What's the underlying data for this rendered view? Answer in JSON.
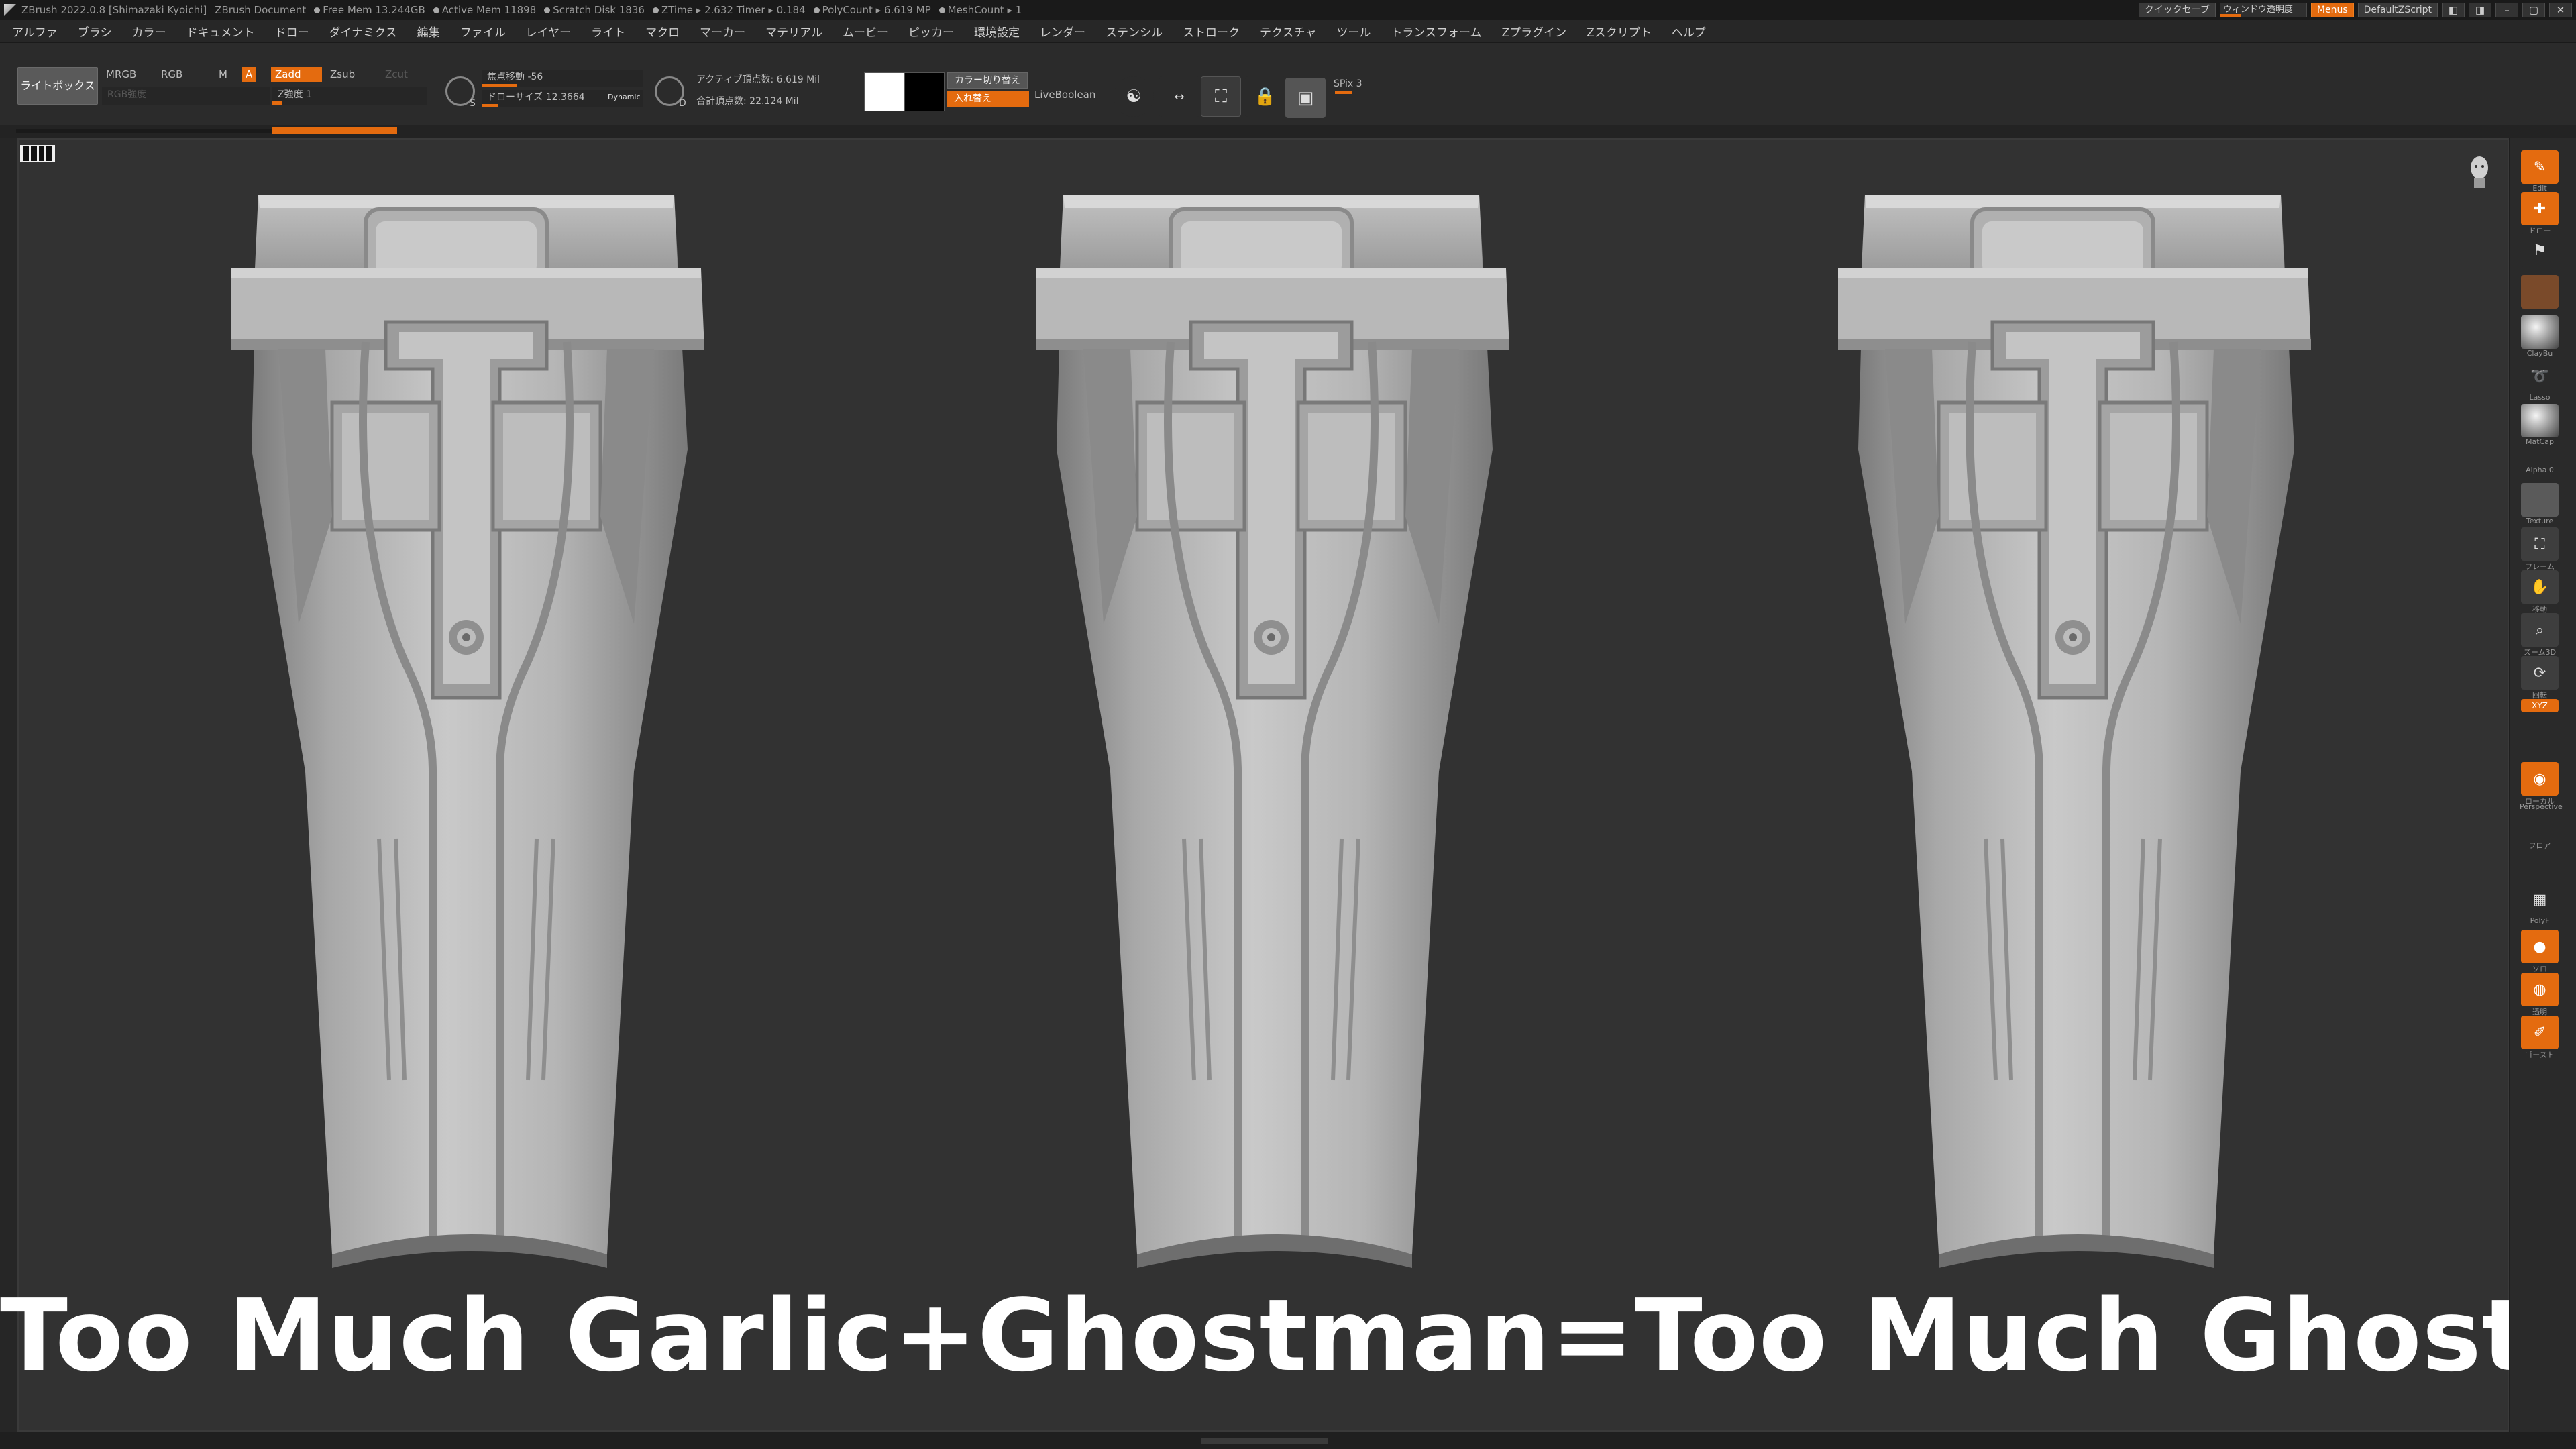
{
  "titlebar": {
    "app": "ZBrush 2022.0.8 [Shimazaki Kyoichi]",
    "document": "ZBrush Document",
    "free_mem": "Free Mem 13.244GB",
    "active_mem": "Active Mem 11898",
    "scratch_disk": "Scratch Disk 1836",
    "ztime": "ZTime ▸ 2.632 Timer ▸ 0.184",
    "polycount": "PolyCount ▸ 6.619 MP",
    "meshcount": "MeshCount ▸ 1",
    "quicksave": "クイックセーブ",
    "window_transparency": "ウィンドウ透明度",
    "menus": "Menus",
    "default_zscript": "DefaultZScript"
  },
  "menu": [
    "アルファ",
    "ブラシ",
    "カラー",
    "ドキュメント",
    "ドロー",
    "ダイナミクス",
    "編集",
    "ファイル",
    "レイヤー",
    "ライト",
    "マクロ",
    "マーカー",
    "マテリアル",
    "ムービー",
    "ピッカー",
    "環境設定",
    "レンダー",
    "ステンシル",
    "ストローク",
    "テクスチャ",
    "ツール",
    "トランスフォーム",
    "Zプラグイン",
    "Zスクリプト",
    "ヘルプ"
  ],
  "toolbar": {
    "lightbox": "ライトボックス",
    "mrgb": "MRGB",
    "rgb": "RGB",
    "m": "M",
    "a": "A",
    "zadd": "Zadd",
    "zsub": "Zsub",
    "zcut": "Zcut",
    "rgb_intensity": "RGB強度",
    "z_intensity": "Z強度 1",
    "focal_shift": "焦点移動 -56",
    "draw_size": "ドローサイズ 12.3664",
    "dynamic": "Dynamic",
    "s": "S",
    "d": "D",
    "active_points": "アクティブ頂点数: 6.619 Mil",
    "total_points": "合計頂点数: 22.124 Mil",
    "color_switch": "カラー切り替え",
    "swap": "入れ替え",
    "live_boolean": "LiveBoolean",
    "spix": "SPix 3"
  },
  "shelf": {
    "edit": "Edit",
    "draw": "ドロー",
    "claybu": "ClayBu",
    "lasso": "Lasso",
    "matcap": "MatCap",
    "alpha": "Alpha 0",
    "texture": "Texture",
    "frame": "フレーム",
    "move": "移動",
    "zoom": "ズーム3D",
    "rotate": "回転",
    "xyz": "XYZ",
    "local": "ローカル",
    "perspective": "Perspective",
    "floor": "フロア",
    "polyf": "PolyF",
    "solo": "ソロ",
    "transp": "透明",
    "ghost": "ゴースト"
  },
  "caption": "Too Much Garlic+Ghostman=Too Much Ghost",
  "colors": {
    "accent": "#e46b0f",
    "canvas": "#323232",
    "mesh": "#b8b8b8"
  }
}
